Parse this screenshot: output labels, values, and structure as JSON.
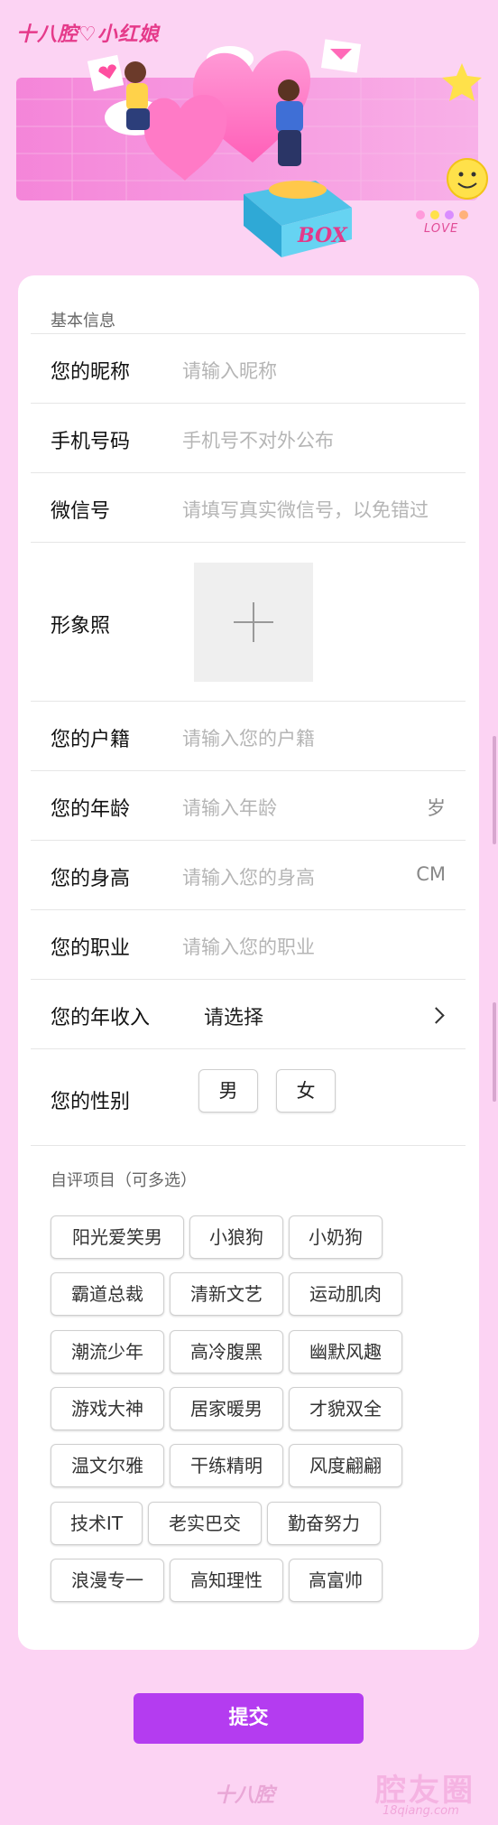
{
  "brand": {
    "logo_text": "十八腔♡小红娘",
    "love_text": "LOVE",
    "box_text": "BOX"
  },
  "basic_section_title": "基本信息",
  "fields": {
    "nickname": {
      "label": "您的昵称",
      "placeholder": "请输入昵称"
    },
    "phone": {
      "label": "手机号码",
      "placeholder": "手机号不对外公布"
    },
    "wechat": {
      "label": "微信号",
      "placeholder": "请填写真实微信号，以免错过"
    },
    "photo": {
      "label": "形象照"
    },
    "hometown": {
      "label": "您的户籍",
      "placeholder": "请输入您的户籍"
    },
    "age": {
      "label": "您的年龄",
      "placeholder": "请输入年龄",
      "unit": "岁"
    },
    "height": {
      "label": "您的身高",
      "placeholder": "请输入您的身高",
      "unit": "CM"
    },
    "job": {
      "label": "您的职业",
      "placeholder": "请输入您的职业"
    },
    "income": {
      "label": "您的年收入",
      "value": "请选择"
    },
    "gender": {
      "label": "您的性别",
      "options": [
        "男",
        "女"
      ]
    }
  },
  "self_eval_title": "自评项目（可多选）",
  "tags": [
    [
      "阳光爱笑男",
      "小狼狗",
      "小奶狗"
    ],
    [
      "霸道总裁",
      "清新文艺",
      "运动肌肉"
    ],
    [
      "潮流少年",
      "高冷腹黑",
      "幽默风趣"
    ],
    [
      "游戏大神",
      "居家暖男",
      "才貌双全"
    ],
    [
      "温文尔雅",
      "干练精明",
      "风度翩翩"
    ],
    [
      "技术IT",
      "老实巴交",
      "勤奋努力"
    ],
    [
      "浪漫专一",
      "高知理性",
      "高富帅"
    ]
  ],
  "submit_label": "提交",
  "footer_logo": "十八腔",
  "watermark": {
    "text": "腔友圈",
    "url": "18qiang.com"
  }
}
